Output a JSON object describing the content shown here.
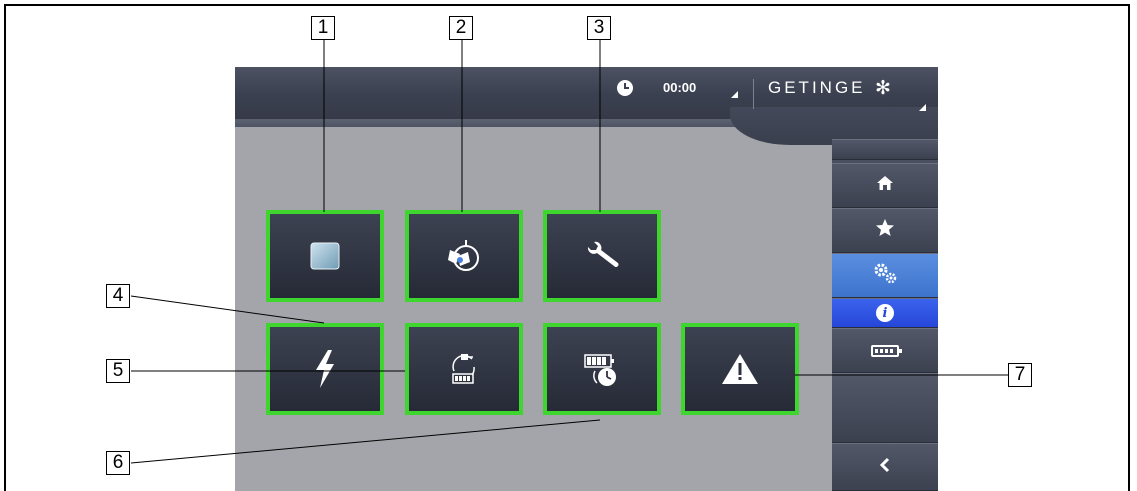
{
  "header": {
    "time": "00:00",
    "brand": "GETINGE",
    "brand_logo": "✻"
  },
  "sidebar": {
    "items": [
      {
        "name": "home",
        "icon": "home-icon",
        "glyph": "⌂"
      },
      {
        "name": "favorites",
        "icon": "star-icon",
        "glyph": "★"
      },
      {
        "name": "settings",
        "icon": "gears-icon",
        "glyph": "⚙",
        "active": true
      },
      {
        "name": "info",
        "icon": "info-icon",
        "glyph": "i"
      },
      {
        "name": "battery",
        "icon": "battery-icon"
      },
      {
        "name": "back",
        "icon": "chevron-left-icon",
        "glyph": "‹"
      }
    ]
  },
  "tiles": [
    {
      "id": "display",
      "icon": "display-panel-icon"
    },
    {
      "id": "light-head",
      "icon": "light-head-icon"
    },
    {
      "id": "maintenance",
      "icon": "wrench-icon",
      "glyph": "🔧"
    },
    {
      "id": "power",
      "icon": "lightning-icon",
      "glyph": "⚡"
    },
    {
      "id": "battery-charge",
      "icon": "battery-charge-icon"
    },
    {
      "id": "battery-schedule",
      "icon": "battery-timer-icon"
    },
    {
      "id": "warning",
      "icon": "warning-icon",
      "glyph": "!"
    }
  ],
  "callouts": [
    "1",
    "2",
    "3",
    "4",
    "5",
    "6",
    "7"
  ],
  "colors": {
    "tile_border": "#3fd52f",
    "screen_bg": "#a3a5ab",
    "sidebar_active": "#4a83dc",
    "sidebar_info": "#2d4fe0"
  }
}
